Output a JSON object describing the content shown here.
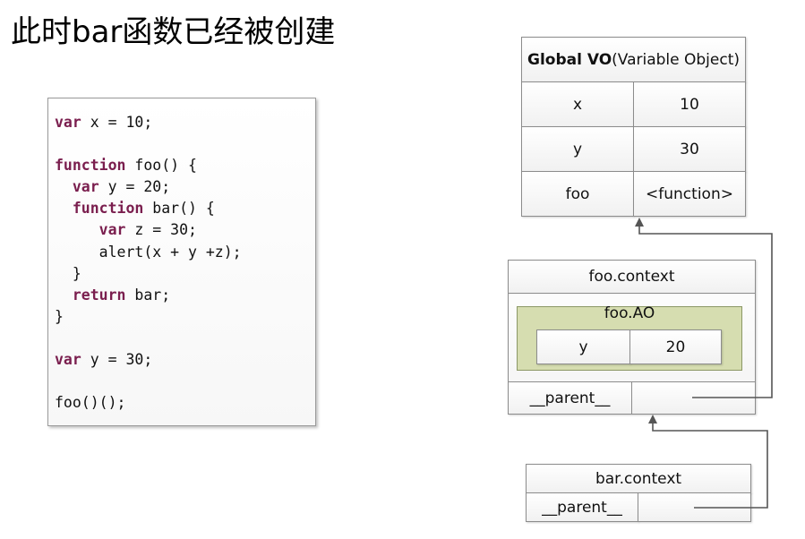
{
  "title": "此时bar函数已经被创建",
  "code": {
    "lines": [
      [
        {
          "t": "var",
          "kw": true
        },
        {
          "t": " x = 10;"
        }
      ],
      [],
      [
        {
          "t": "function",
          "kw": true
        },
        {
          "t": " foo() {"
        }
      ],
      [
        {
          "t": "  "
        },
        {
          "t": "var",
          "kw": true
        },
        {
          "t": " y = 20;"
        }
      ],
      [
        {
          "t": "  "
        },
        {
          "t": "function",
          "kw": true
        },
        {
          "t": " bar() {"
        }
      ],
      [
        {
          "t": "     "
        },
        {
          "t": "var",
          "kw": true
        },
        {
          "t": " z = 30;"
        }
      ],
      [
        {
          "t": "     alert(x + y +z);"
        }
      ],
      [
        {
          "t": "  }"
        }
      ],
      [
        {
          "t": "  "
        },
        {
          "t": "return",
          "kw": true
        },
        {
          "t": " bar;"
        }
      ],
      [
        {
          "t": "}"
        }
      ],
      [],
      [
        {
          "t": "var",
          "kw": true
        },
        {
          "t": " y = 30;"
        }
      ],
      [],
      [
        {
          "t": "foo()();"
        }
      ]
    ]
  },
  "global_vo": {
    "title_bold": "Global VO",
    "title_rest": "(Variable Object)",
    "rows": [
      {
        "name": "x",
        "value": "10"
      },
      {
        "name": "y",
        "value": "30"
      },
      {
        "name": "foo",
        "value": "<function>"
      }
    ]
  },
  "foo_context": {
    "title": "foo.context",
    "ao_label": "foo.AO",
    "ao_name": "y",
    "ao_value": "20",
    "parent_label": "__parent__"
  },
  "bar_context": {
    "title": "bar.context",
    "parent_label": "__parent__"
  },
  "colors": {
    "keyword": "#7a1e4e",
    "ao_fill": "#d6ddb0",
    "arrow": "#555555"
  }
}
